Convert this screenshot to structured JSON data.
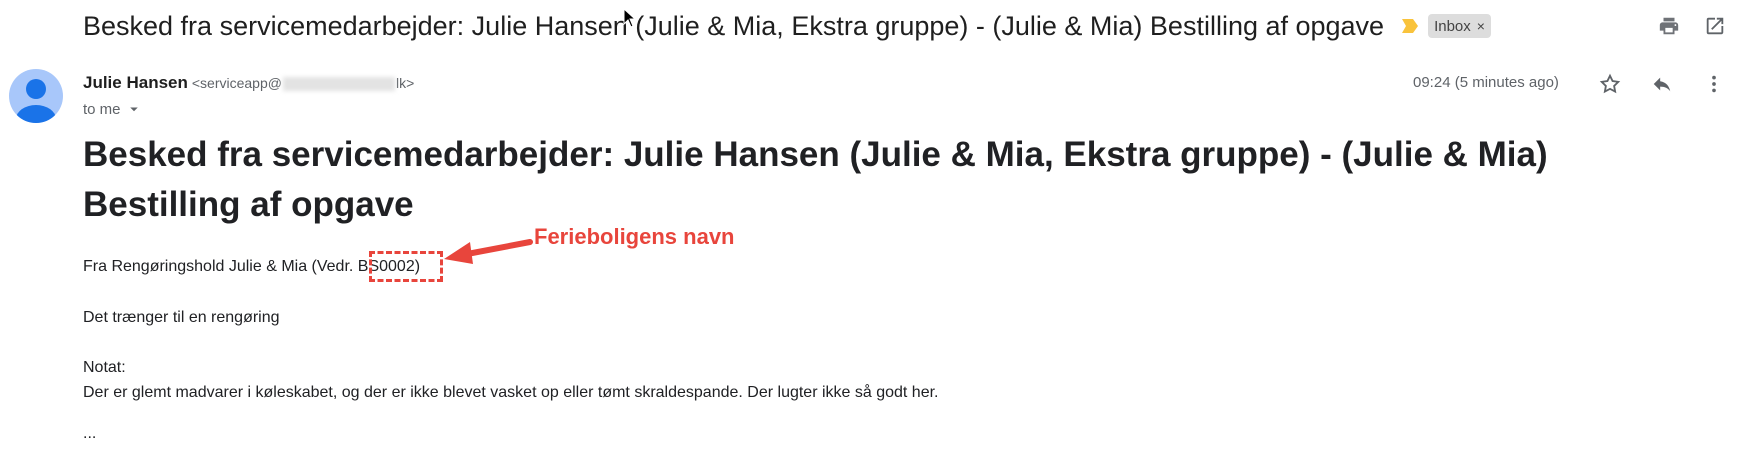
{
  "header": {
    "subject": "Besked fra servicemedarbejder: Julie Hansen (Julie & Mia, Ekstra gruppe) - (Julie & Mia) Bestilling af opgave",
    "label_chip": "Inbox",
    "label_chip_close": "×",
    "icons": [
      "print-icon",
      "open-in-new-window-icon"
    ]
  },
  "message": {
    "sender_name": "Julie Hansen",
    "sender_email_start": "<serviceapp@",
    "sender_email_end": "lk>",
    "to_line": "to me",
    "time": "09:24 (5 minutes ago)",
    "icons": [
      "star-icon",
      "reply-icon",
      "more-vert-icon"
    ]
  },
  "body": {
    "title": "Besked fra servicemedarbejder: Julie Hansen (Julie & Mia, Ekstra gruppe) - (Julie & Mia) Bestilling af opgave",
    "from_line": "Fra Rengøringshold Julie & Mia (Vedr. BS0002)",
    "line2": "Det trænger til en rengøring",
    "notat_label": "Notat:",
    "notat_text": "Der er glemt madvarer i køleskabet, og der er ikke blevet vasket op eller tømt skraldespande. Der lugter ikke så godt her.",
    "ellipsis": "..."
  },
  "annotation": {
    "label": "Ferieboligens navn",
    "color": "#e8453c"
  },
  "colors": {
    "avatar_bg": "#a8c7fa",
    "avatar_fg": "#1a73e8",
    "importance": "#f9c33c",
    "chip_bg": "#dddddd"
  }
}
